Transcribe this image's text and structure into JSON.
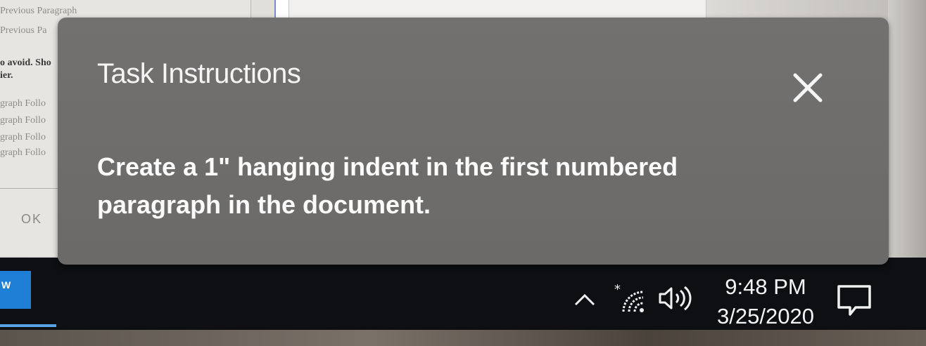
{
  "document": {
    "text_lines": [
      "Previous Paragraph",
      "Previous Pa",
      "o avoid. Sho",
      "ier.",
      "graph Follo",
      "graph Follo",
      "graph Follo",
      "graph Follo"
    ],
    "ok_label": "OK"
  },
  "task_panel": {
    "title": "Task Instructions",
    "instruction": "Create a 1\" hanging indent in the first numbered paragraph in the document.",
    "close_icon": "close-x-icon"
  },
  "taskbar": {
    "start_label": "W",
    "tray_icons": [
      "chevron-up-icon",
      "wifi-icon",
      "volume-icon"
    ],
    "clock": {
      "time": "9:48 PM",
      "date": "3/25/2020"
    },
    "notification_icon": "notification-icon"
  },
  "colors": {
    "panel_bg": "#6f6d6b",
    "panel_text": "#f5f5f5",
    "taskbar_bg": "#0e0f12",
    "start_blue": "#1f7fd6"
  }
}
